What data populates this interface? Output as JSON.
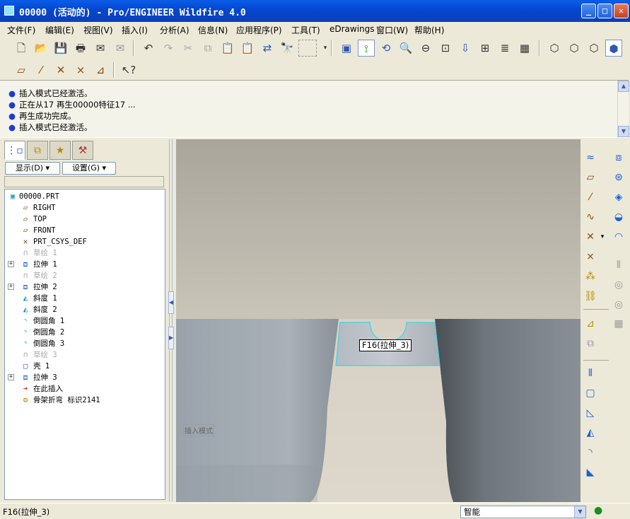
{
  "window": {
    "title": "00000 (活动的) - Pro/ENGINEER Wildfire 4.0",
    "buttons": [
      "_",
      "□",
      "✕"
    ]
  },
  "menu": [
    "文件(F)",
    "编辑(E)",
    "视图(V)",
    "插入(I)",
    "分析(A)",
    "信息(N)",
    "应用程序(P)",
    "工具(T)",
    "eDrawings",
    "窗口(W)",
    "帮助(H)"
  ],
  "messages": [
    "插入模式已经激活。",
    "正在从17 再生00000特征17 ...",
    "再生成功完成。",
    "插入模式已经激活。"
  ],
  "navigator": {
    "show_label": "显示(D) ▾",
    "settings_label": "设置(G) ▾"
  },
  "tree": [
    {
      "label": "00000.PRT",
      "icon": "part-icon",
      "dim": false,
      "expandable": false,
      "indent": 0
    },
    {
      "label": "RIGHT",
      "icon": "datum-plane-icon",
      "dim": false,
      "expandable": false,
      "indent": 1
    },
    {
      "label": "TOP",
      "icon": "datum-plane-icon",
      "dim": false,
      "expandable": false,
      "indent": 1
    },
    {
      "label": "FRONT",
      "icon": "datum-plane-icon",
      "dim": false,
      "expandable": false,
      "indent": 1
    },
    {
      "label": "PRT_CSYS_DEF",
      "icon": "csys-icon",
      "dim": false,
      "expandable": false,
      "indent": 1
    },
    {
      "label": "草绘 1",
      "icon": "sketch-icon",
      "dim": true,
      "expandable": false,
      "indent": 1
    },
    {
      "label": "拉伸 1",
      "icon": "extrude-icon",
      "dim": false,
      "expandable": true,
      "indent": 1
    },
    {
      "label": "草绘 2",
      "icon": "sketch-icon",
      "dim": true,
      "expandable": false,
      "indent": 1
    },
    {
      "label": "拉伸 2",
      "icon": "extrude-icon",
      "dim": false,
      "expandable": true,
      "indent": 1
    },
    {
      "label": "斜度 1",
      "icon": "draft-icon",
      "dim": false,
      "expandable": false,
      "indent": 1
    },
    {
      "label": "斜度 2",
      "icon": "draft-icon",
      "dim": false,
      "expandable": false,
      "indent": 1
    },
    {
      "label": "倒圆角 1",
      "icon": "round-icon",
      "dim": false,
      "expandable": false,
      "indent": 1
    },
    {
      "label": "倒圆角 2",
      "icon": "round-icon",
      "dim": false,
      "expandable": false,
      "indent": 1
    },
    {
      "label": "倒圆角 3",
      "icon": "round-icon",
      "dim": false,
      "expandable": false,
      "indent": 1
    },
    {
      "label": "草绘 3",
      "icon": "sketch-icon",
      "dim": true,
      "expandable": false,
      "indent": 1
    },
    {
      "label": "壳 1",
      "icon": "shell-icon",
      "dim": false,
      "expandable": false,
      "indent": 1
    },
    {
      "label": "拉伸 3",
      "icon": "extrude-icon",
      "dim": false,
      "expandable": true,
      "indent": 1
    },
    {
      "label": "在此插入",
      "icon": "insert-here-icon",
      "dim": false,
      "expandable": false,
      "indent": 1
    },
    {
      "label": "骨架折弯 标识2141",
      "icon": "spinal-bend-icon",
      "dim": false,
      "expandable": false,
      "indent": 1
    }
  ],
  "viewport": {
    "tooltip": "F16(拉伸_3)",
    "insert_mode_label": "插入模式"
  },
  "status": {
    "left_text": "F16(拉伸_3)",
    "filter_value": "智能"
  },
  "colors": {
    "title_bar": "#0a5ee8",
    "highlight_edge": "#3ad6e6",
    "model_left": "#9ba3ab",
    "model_right": "#7d848c"
  }
}
